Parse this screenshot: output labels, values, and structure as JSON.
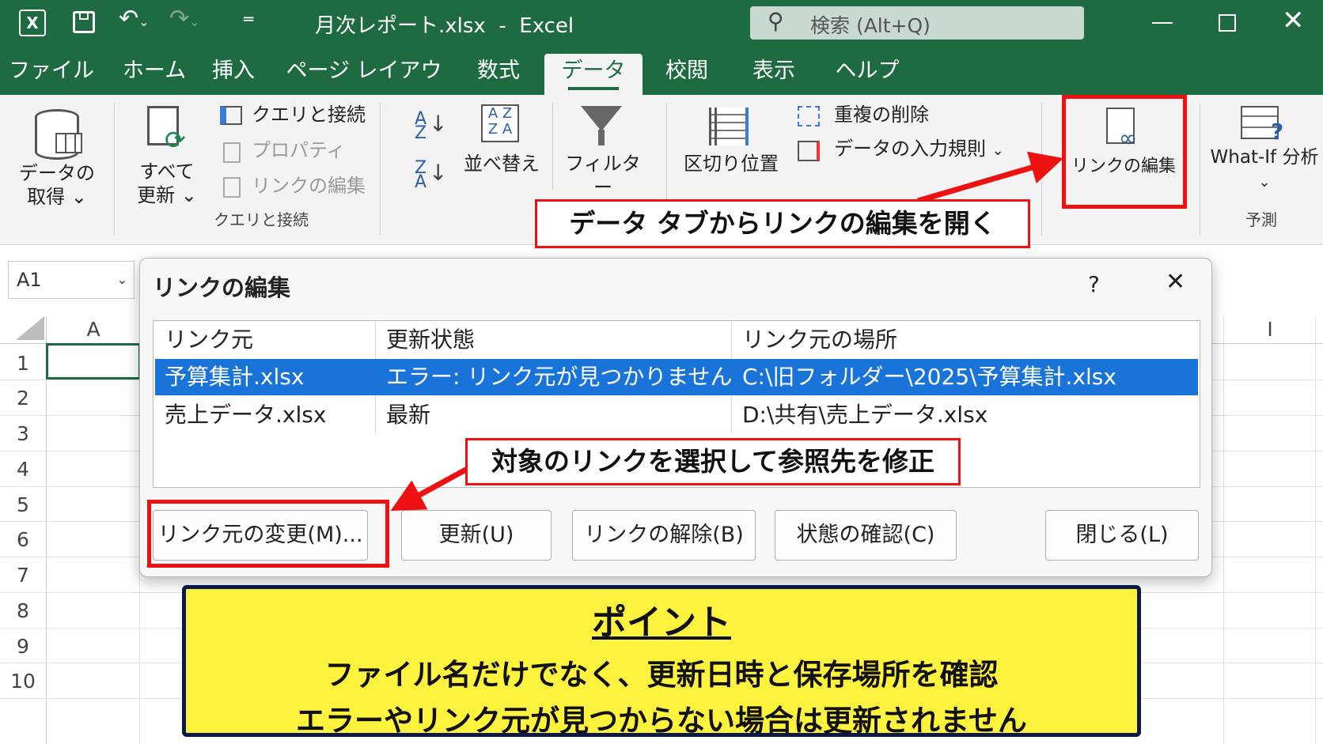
{
  "titlebar": {
    "app_icon": "X",
    "filename": "月次レポート.xlsx",
    "separator": "-",
    "app": "Excel",
    "search_placeholder": "検索 (Alt+Q)"
  },
  "tabs": [
    "ファイル",
    "ホーム",
    "挿入",
    "ページ レイアウト",
    "数式",
    "データ",
    "校閲",
    "表示",
    "ヘルプ"
  ],
  "ribbon": {
    "get_data_1": "データの",
    "get_data_2": "取得 ⌄",
    "refresh_all_1": "すべて",
    "refresh_all_2": "更新 ⌄",
    "queries_connections": "クエリと接続",
    "properties": "プロパティ",
    "edit_links_small": "リンクの編集",
    "group_queries": "クエリと接続",
    "sort": "並べ替え",
    "filter": "フィルター",
    "text_to_columns": "区切り位置",
    "remove_duplicates": "重複の削除",
    "data_validation": "データの入力規則",
    "edit_links": "リンクの編集",
    "whatif": "What-If 分析",
    "whatif_arrow": "⌄",
    "group_forecast": "予測"
  },
  "namebox": {
    "value": "A1"
  },
  "sheet": {
    "col_a": "A",
    "col_i": "I",
    "rows": [
      "1",
      "2",
      "3",
      "4",
      "5",
      "6",
      "7",
      "8",
      "9",
      "10"
    ]
  },
  "dialog": {
    "title": "リンクの編集",
    "help": "?",
    "close": "✕",
    "headers": [
      "リンク元",
      "更新状態",
      "リンク元の場所"
    ],
    "rows": [
      {
        "source": "予算集計.xlsx",
        "status": "エラー: リンク元が見つかりません",
        "location": "C:\\旧フォルダー\\2025\\予算集計.xlsx"
      },
      {
        "source": "売上データ.xlsx",
        "status": "最新",
        "location": "D:\\共有\\売上データ.xlsx"
      }
    ],
    "buttons": {
      "change_source": "リンク元の変更(M)...",
      "update": "更新(U)",
      "break": "リンクの解除(B)",
      "check_status": "状態の確認(C)",
      "close": "閉じる(L)"
    }
  },
  "callouts": {
    "top": "データ タブからリンクの編集を開く",
    "middle": "対象のリンクを選択して参照先を修正"
  },
  "point": {
    "title": "ポイント",
    "line1": "ファイル名だけでなく、更新日時と保存場所を確認",
    "line2": "エラーやリンク元が見つからない場合は更新されません"
  },
  "colors": {
    "excel_green": "#1e6b41",
    "highlight_red": "#e11111",
    "selection_blue": "#1a73d9",
    "point_yellow": "#fdf23d",
    "point_border": "#0b1a4a"
  }
}
